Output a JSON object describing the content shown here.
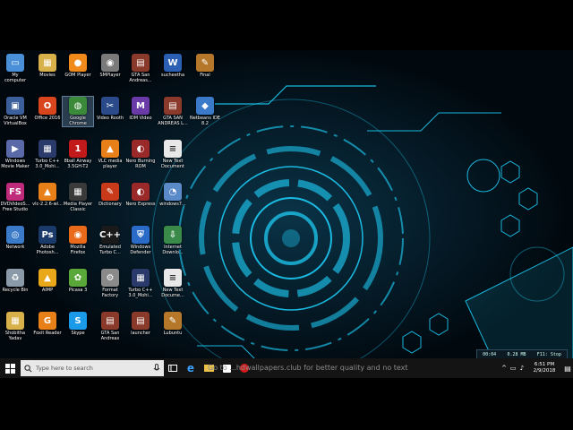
{
  "desktop": {
    "icons": [
      {
        "label": "My\ncomputer",
        "color": "#4a90d9",
        "glyph": "▭",
        "icon": "computer-icon"
      },
      {
        "label": "Movies",
        "color": "#d8b14a",
        "glyph": "▦",
        "icon": "folder-icon"
      },
      {
        "label": "GOM Player",
        "color": "#f08a1a",
        "glyph": "●",
        "icon": "gom-player-icon"
      },
      {
        "label": "SMPlayer",
        "color": "#7a7a7a",
        "glyph": "◉",
        "icon": "smplayer-icon"
      },
      {
        "label": "GTA San\nAndreas...",
        "color": "#8a3a2a",
        "glyph": "▤",
        "icon": "gta-icon"
      },
      {
        "label": "sucheetha",
        "color": "#2b5fb3",
        "glyph": "W",
        "icon": "word-doc-icon"
      },
      {
        "label": "Final",
        "color": "#b5782a",
        "glyph": "✎",
        "icon": "winrar-icon"
      },
      {
        "label": "Oracle VM\nVirtualBox",
        "color": "#3a5f9a",
        "glyph": "▣",
        "icon": "virtualbox-icon"
      },
      {
        "label": "Office 2016",
        "color": "#d9461e",
        "glyph": "O",
        "icon": "office-icon"
      },
      {
        "label": "Google\nChrome",
        "color": "#3a8a3a",
        "glyph": "◍",
        "icon": "chrome-icon"
      },
      {
        "label": "Video Rooth",
        "color": "#2a4a8a",
        "glyph": "✂",
        "icon": "video-icon"
      },
      {
        "label": "IDM Video",
        "color": "#6a3aa8",
        "glyph": "M",
        "icon": "idm-icon"
      },
      {
        "label": "GTA SAN\nANDREAS L...",
        "color": "#8a3a2a",
        "glyph": "▤",
        "icon": "gta-icon"
      },
      {
        "label": "Netbeans IDE\n8.2",
        "color": "#3a7ac8",
        "glyph": "◆",
        "icon": "netbeans-icon"
      },
      {
        "label": "Windows\nMovie Maker",
        "color": "#5a6aa8",
        "glyph": "▶",
        "icon": "movie-maker-icon"
      },
      {
        "label": "Turbo C++\n3.0_Mohi...",
        "color": "#2a3a6a",
        "glyph": "▦",
        "icon": "turbo-c-icon"
      },
      {
        "label": "8ball Airway\n3.5GH-T2",
        "color": "#c21a1a",
        "glyph": "1",
        "icon": "8ball-icon"
      },
      {
        "label": "VLC media\nplayer",
        "color": "#e8801a",
        "glyph": "▲",
        "icon": "vlc-icon"
      },
      {
        "label": "Nero Burning\nROM",
        "color": "#9a2a2a",
        "glyph": "◐",
        "icon": "nero-icon"
      },
      {
        "label": "New Text\nDocument",
        "color": "#e8e8e8",
        "glyph": "≡",
        "icon": "text-document-icon"
      },
      null,
      {
        "label": "DVDVideoS...\nFree Studio",
        "color": "#c02a7a",
        "glyph": "FS",
        "icon": "free-studio-icon"
      },
      {
        "label": "vlc-2.2.6-wi...",
        "color": "#e8801a",
        "glyph": "▲",
        "icon": "vlc-icon"
      },
      {
        "label": "Media Player\nClassic",
        "color": "#3a3a3a",
        "glyph": "▦",
        "icon": "media-player-classic-icon"
      },
      {
        "label": "Dictionary",
        "color": "#c83a1a",
        "glyph": "✎",
        "icon": "dictionary-icon"
      },
      {
        "label": "Nero Express",
        "color": "#9a2a2a",
        "glyph": "◐",
        "icon": "nero-icon"
      },
      {
        "label": "windows7...",
        "color": "#5a8ac8",
        "glyph": "◔",
        "icon": "windows-icon"
      },
      null,
      {
        "label": "Network",
        "color": "#3a7ac8",
        "glyph": "◎",
        "icon": "network-icon"
      },
      {
        "label": "Adobe\nPhotosh...",
        "color": "#1a3a6a",
        "glyph": "Ps",
        "icon": "photoshop-icon"
      },
      {
        "label": "Mozilla\nFirefox",
        "color": "#e86a1a",
        "glyph": "◉",
        "icon": "firefox-icon"
      },
      {
        "label": "Emulated\nTurbo C...",
        "color": "#1a1a1a",
        "glyph": "C++",
        "icon": "turbo-c-icon"
      },
      {
        "label": "Windows\nDefender",
        "color": "#2a6ac8",
        "glyph": "⛨",
        "icon": "defender-icon"
      },
      {
        "label": "Internet\nDownlo...",
        "color": "#3a8a4a",
        "glyph": "⇩",
        "icon": "idm-icon"
      },
      null,
      {
        "label": "Recycle Bin",
        "color": "#8a9aa8",
        "glyph": "♻",
        "icon": "recycle-bin-icon"
      },
      {
        "label": "AIMP",
        "color": "#e8a81a",
        "glyph": "▲",
        "icon": "aimp-icon"
      },
      {
        "label": "Picasa 3",
        "color": "#5aa83a",
        "glyph": "✿",
        "icon": "picasa-icon"
      },
      {
        "label": "Format\nFactory",
        "color": "#8a8a8a",
        "glyph": "⚙",
        "icon": "format-factory-icon"
      },
      {
        "label": "Turbo C++\n3.0_Mohi...",
        "color": "#2a3a6a",
        "glyph": "▦",
        "icon": "turbo-c-icon"
      },
      {
        "label": "New Text\nDocume...",
        "color": "#e8e8e8",
        "glyph": "≡",
        "icon": "text-document-icon"
      },
      null,
      {
        "label": "Shobitha\nYadav",
        "color": "#d8b14a",
        "glyph": "▦",
        "icon": "folder-icon"
      },
      {
        "label": "Foxit Reader",
        "color": "#e8801a",
        "glyph": "G",
        "icon": "foxit-icon"
      },
      {
        "label": "Skype",
        "color": "#1a9ae8",
        "glyph": "S",
        "icon": "skype-icon"
      },
      {
        "label": "GTA San\nAndreas",
        "color": "#8a3a2a",
        "glyph": "▤",
        "icon": "gta-icon"
      },
      {
        "label": "launcher",
        "color": "#8a3a2a",
        "glyph": "▤",
        "icon": "launcher-icon"
      },
      {
        "label": "Lubuntu",
        "color": "#b5782a",
        "glyph": "✎",
        "icon": "winrar-icon"
      },
      null
    ]
  },
  "taskbar": {
    "search_placeholder": "Type here to search",
    "watermark": "Go to ...hdwallpapers.club for better quality and no text",
    "recorder": [
      "00:04",
      "0.28 MB",
      "F11: Stop"
    ],
    "clock_time": "6:51 PM",
    "clock_date": "2/9/2018"
  },
  "colors": {
    "accent": "#1fd4ff",
    "taskbar": "#141414"
  }
}
